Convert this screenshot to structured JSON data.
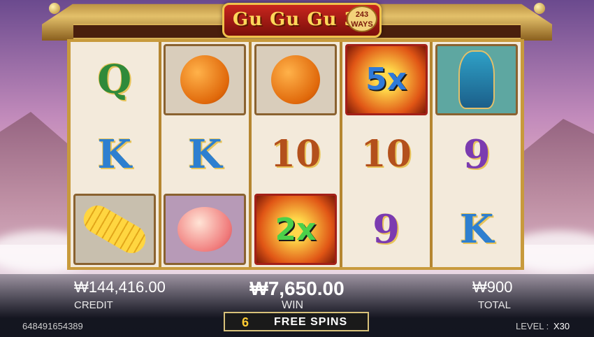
{
  "logo": {
    "title": "Gu Gu Gu 3",
    "ways_number": "243",
    "ways_label": "WAYS"
  },
  "reels": [
    [
      {
        "type": "letter",
        "value": "Q",
        "style": "q"
      },
      {
        "type": "letter",
        "value": "K",
        "style": "k"
      },
      {
        "type": "symbol",
        "icon": "corn-icon"
      }
    ],
    [
      {
        "type": "symbol",
        "icon": "orange-icon"
      },
      {
        "type": "letter",
        "value": "K",
        "style": "k"
      },
      {
        "type": "symbol",
        "icon": "peach-icon"
      }
    ],
    [
      {
        "type": "symbol",
        "icon": "orange-icon"
      },
      {
        "type": "letter",
        "value": "10",
        "style": "ten"
      },
      {
        "type": "multiplier",
        "value": "2x",
        "style": "mult-green"
      }
    ],
    [
      {
        "type": "multiplier",
        "value": "5x",
        "style": "mult-blue"
      },
      {
        "type": "letter",
        "value": "10",
        "style": "ten"
      },
      {
        "type": "letter",
        "value": "9",
        "style": "nine"
      }
    ],
    [
      {
        "type": "symbol",
        "icon": "vase-icon"
      },
      {
        "type": "letter",
        "value": "9",
        "style": "nine"
      },
      {
        "type": "letter",
        "value": "K",
        "style": "k"
      }
    ]
  ],
  "credit": {
    "value": "₩144,416.00",
    "label": "CREDIT"
  },
  "win": {
    "value": "₩7,650.00",
    "label": "WIN"
  },
  "total": {
    "value": "₩900",
    "label": "TOTAL"
  },
  "free_spins": {
    "count": "6",
    "label": "FREE SPINS"
  },
  "game_id": "648491654389",
  "level": {
    "label": "LEVEL :",
    "value": "X30"
  }
}
